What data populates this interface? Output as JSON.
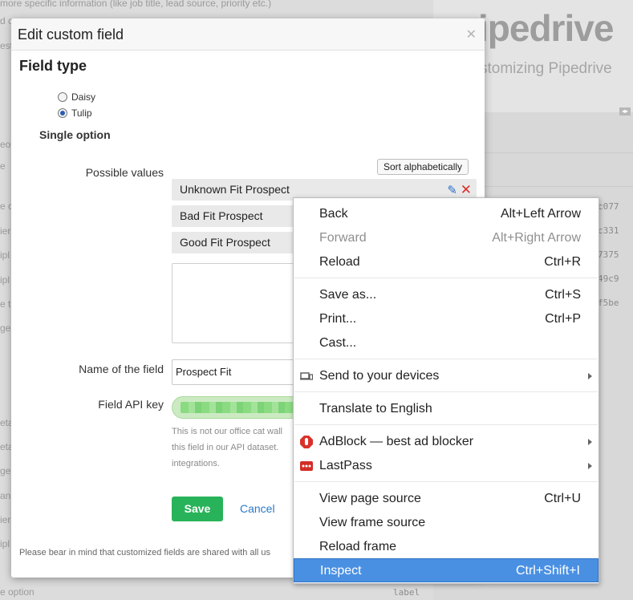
{
  "background": {
    "logo": "ipedrive",
    "subtitle": "stomizing Pipedrive",
    "collapse": "◂▸",
    "top_fragment_1": "more specific information (like job title, lead source, priority etc.)",
    "left_fragments": [
      "d c",
      "est",
      "eo",
      "e",
      "e c",
      "ier",
      "ipl",
      "ipl",
      "e t",
      "ger",
      "eta",
      "eta",
      "ger",
      "ani",
      "ier",
      "ipl",
      "e option"
    ],
    "codes": [
      "c077",
      "c331",
      "7375",
      "49c9",
      "f5be"
    ],
    "label_text": "label"
  },
  "dialog": {
    "title": "Edit custom field",
    "section_title": "Field type",
    "radio_options": [
      {
        "label": "Daisy",
        "checked": false
      },
      {
        "label": "Tulip",
        "checked": true
      }
    ],
    "field_type_name": "Single option",
    "possible_values_label": "Possible values",
    "sort_button": "Sort alphabetically",
    "values": [
      "Unknown Fit Prospect",
      "Bad Fit Prospect",
      "Good Fit Prospect"
    ],
    "name_label": "Name of the field",
    "name_value": "Prospect Fit",
    "api_key_label": "Field API key",
    "help_lines": [
      "This is not our office cat wall",
      "this field in our API dataset.",
      "integrations."
    ],
    "save_label": "Save",
    "cancel_label": "Cancel",
    "footer_note": "Please bear in mind that customized fields are shared with all us"
  },
  "context_menu": {
    "items": [
      {
        "label": "Back",
        "shortcut": "Alt+Left Arrow"
      },
      {
        "label": "Forward",
        "shortcut": "Alt+Right Arrow"
      },
      {
        "label": "Reload",
        "shortcut": "Ctrl+R"
      },
      {
        "label": "Save as...",
        "shortcut": "Ctrl+S"
      },
      {
        "label": "Print...",
        "shortcut": "Ctrl+P"
      },
      {
        "label": "Cast..."
      },
      {
        "label": "Send to your devices"
      },
      {
        "label": "Translate to English"
      },
      {
        "label": "AdBlock — best ad blocker"
      },
      {
        "label": "LastPass"
      },
      {
        "label": "View page source",
        "shortcut": "Ctrl+U"
      },
      {
        "label": "View frame source"
      },
      {
        "label": "Reload frame"
      },
      {
        "label": "Inspect",
        "shortcut": "Ctrl+Shift+I"
      }
    ]
  },
  "colors": {
    "save": "#28b35a",
    "highlight": "#4a90e2",
    "adblock": "#d9312a",
    "lastpass": "#d32d27"
  }
}
